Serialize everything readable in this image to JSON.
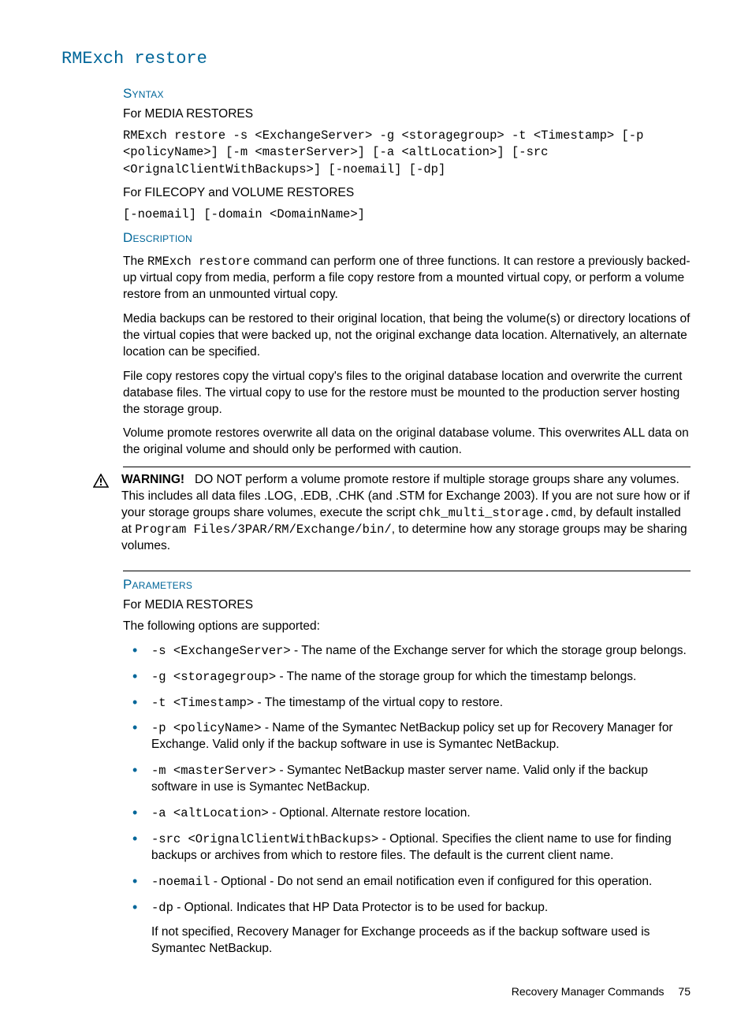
{
  "title": "RMExch restore",
  "syntax": {
    "heading": "Syntax",
    "media_heading": "For MEDIA RESTORES",
    "media_code": "RMExch restore -s <ExchangeServer> -g <storagegroup> -t <Timestamp> [-p <policyName>] [-m <masterServer>] [-a <altLocation>] [-src <OrignalClientWithBackups>] [-noemail] [-dp]",
    "filecopy_heading": "For FILECOPY and VOLUME RESTORES",
    "filecopy_code": "[-noemail] [-domain <DomainName>]"
  },
  "description": {
    "heading": "Description",
    "p1a": "The ",
    "p1cmd": "RMExch restore",
    "p1b": " command can perform one of three functions. It can restore a previously backed-up virtual copy from media, perform a file copy restore from a mounted virtual copy, or perform a volume restore from an unmounted virtual copy.",
    "p2": "Media backups can be restored to their original location, that being the volume(s) or directory locations of the virtual copies that were backed up, not the original exchange data location. Alternatively, an alternate location can be specified.",
    "p3": "File copy restores copy the virtual copy's files to the original database location and overwrite the current database files. The virtual copy to use for the restore must be mounted to the production server hosting the storage group.",
    "p4": "Volume promote restores overwrite all data on the original database volume. This overwrites ALL data on the original volume and should only be performed with caution."
  },
  "warning": {
    "label": "WARNING!",
    "t1": "DO NOT perform a volume promote restore if multiple storage groups share any volumes. This includes all data files .LOG, .EDB, .CHK (and .STM for Exchange 2003). If you are not sure how or if your storage groups share volumes, execute the script ",
    "code1": "chk_multi_storage.cmd",
    "t2": ", by default installed at ",
    "code2": "Program Files/3PAR/RM/Exchange/bin/",
    "t3": ", to determine how any storage groups may be sharing volumes."
  },
  "parameters": {
    "heading": "Parameters",
    "subhead": "For MEDIA RESTORES",
    "lead": "The following options are supported:",
    "items": [
      {
        "code": "-s <ExchangeServer>",
        "text": " - The name of the Exchange server for which the storage group belongs."
      },
      {
        "code": "-g <storagegroup>",
        "text": " - The name of the storage group for which the timestamp belongs."
      },
      {
        "code": "-t <Timestamp>",
        "text": " - The timestamp of the virtual copy to restore."
      },
      {
        "code": "-p <policyName>",
        "text": " - Name of the Symantec NetBackup policy set up for Recovery Manager for Exchange. Valid only if the backup software in use is Symantec NetBackup."
      },
      {
        "code": "-m <masterServer>",
        "text": " - Symantec NetBackup master server name. Valid only if the backup software in use is Symantec NetBackup."
      },
      {
        "code": "-a <altLocation>",
        "text": " - Optional. Alternate restore location."
      },
      {
        "code": "-src <OrignalClientWithBackups>",
        "text": " - Optional. Specifies the client name to use for finding backups or archives from which to restore files. The default is the current client name."
      },
      {
        "code": "-noemail",
        "text": " - Optional - Do not send an email notification even if configured for this operation."
      },
      {
        "code": "-dp",
        "text": " - Optional. Indicates that HP Data Protector is to be used for backup."
      }
    ],
    "trailing": "If not specified, Recovery Manager for Exchange proceeds as if the backup software used is Symantec NetBackup."
  },
  "footer": {
    "section": "Recovery Manager Commands",
    "page": "75"
  }
}
